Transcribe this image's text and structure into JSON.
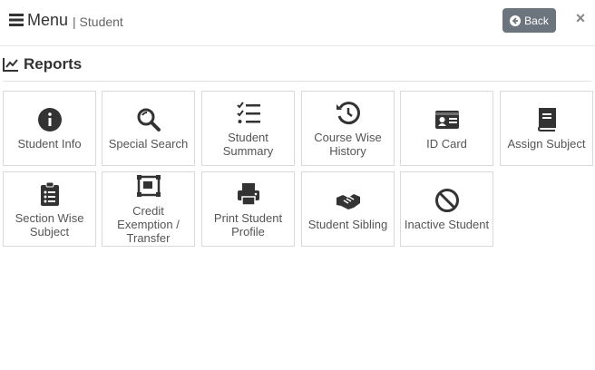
{
  "header": {
    "menu_label": "Menu",
    "breadcrumb": "| Student",
    "back_label": "Back",
    "close_glyph": "×"
  },
  "section": {
    "title": "Reports",
    "icon": "line-chart-icon"
  },
  "tiles": [
    {
      "label": "Student Info",
      "icon": "info-circle-icon"
    },
    {
      "label": "Special Search",
      "icon": "search-icon"
    },
    {
      "label": "Student Summary",
      "icon": "checklist-icon"
    },
    {
      "label": "Course Wise History",
      "icon": "history-icon"
    },
    {
      "label": "ID Card",
      "icon": "id-card-icon"
    },
    {
      "label": "Assign Subject",
      "icon": "book-icon"
    },
    {
      "label": "Section Wise Subject",
      "icon": "clipboard-list-icon"
    },
    {
      "label": "Credit Exemption / Transfer",
      "icon": "object-ungroup-icon"
    },
    {
      "label": "Print Student Profile",
      "icon": "print-icon"
    },
    {
      "label": "Student Sibling",
      "icon": "handshake-icon"
    },
    {
      "label": "Inactive Student",
      "icon": "ban-icon"
    }
  ],
  "colors": {
    "icon": "#333333",
    "text": "#555555",
    "back_button": "#6c757d",
    "border": "#d9d9d9"
  }
}
